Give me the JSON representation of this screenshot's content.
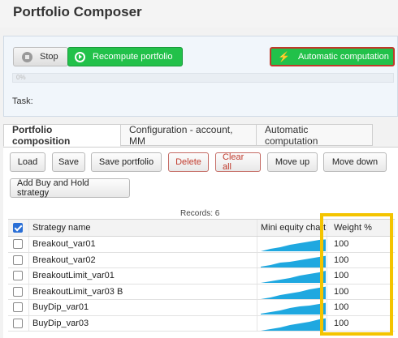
{
  "app": {
    "title": "Portfolio Composer"
  },
  "control": {
    "stop_label": "Stop",
    "recompute_label": "Recompute portfolio",
    "auto_label": "Automatic computation",
    "progress_text": "0%",
    "task_label": "Task:"
  },
  "tabs": [
    {
      "label": "Portfolio composition",
      "active": true
    },
    {
      "label": "Configuration - account, MM",
      "active": false
    },
    {
      "label": "Automatic computation",
      "active": false
    }
  ],
  "toolbar": {
    "load": "Load",
    "save": "Save",
    "save_portfolio": "Save portfolio",
    "delete": "Delete",
    "clear_all": "Clear all",
    "move_up": "Move up",
    "move_down": "Move down",
    "add_bh": "Add Buy and Hold strategy"
  },
  "records_label": "Records: 6",
  "table": {
    "columns": {
      "name": "Strategy name",
      "chart": "Mini equity chart",
      "weight": "Weight %"
    },
    "rows": [
      {
        "name": "Breakout_var01",
        "weight": "100"
      },
      {
        "name": "Breakout_var02",
        "weight": "100"
      },
      {
        "name": "BreakoutLimit_var01",
        "weight": "100"
      },
      {
        "name": "BreakoutLimit_var03 B",
        "weight": "100"
      },
      {
        "name": "BuyDip_var01",
        "weight": "100"
      },
      {
        "name": "BuyDip_var03",
        "weight": "100"
      }
    ]
  },
  "colors": {
    "accent_green": "#22c14a",
    "highlight": "#f4c400",
    "equity_fill": "#1fa8e0"
  }
}
